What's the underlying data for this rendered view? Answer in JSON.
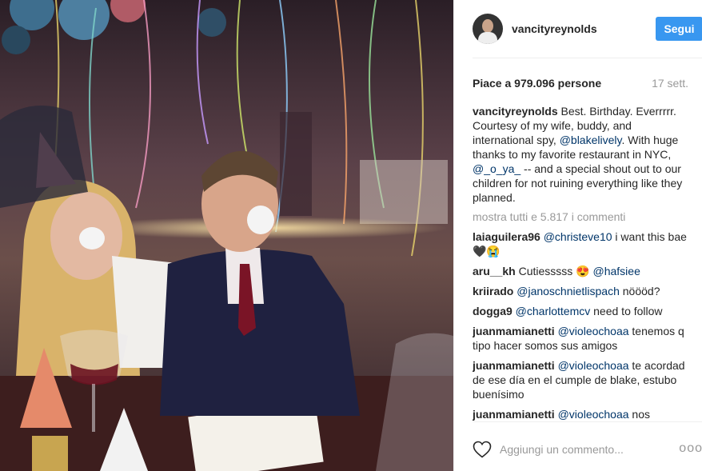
{
  "post": {
    "username": "vancityreynolds",
    "follow_label": "Segui",
    "likes_text": "Piace a 979.096 persone",
    "time_text": "17 sett.",
    "caption": {
      "user": "vancityreynolds",
      "text_1": " Best. Birthday. Everrrrr. Courtesy of my wife, buddy, and international spy, ",
      "mention_1": "@blakelively",
      "text_2": ". With huge thanks to my favorite restaurant in NYC, ",
      "mention_2": "@_o_ya_",
      "text_3": " -- and a special shout out to our children for not ruining everything like they planned."
    },
    "view_all": "mostra tutti e 5.817 i commenti",
    "comments": [
      {
        "user": "laiaguilera96",
        "mention": "@christeve10",
        "text": " i want this bae🖤😭"
      },
      {
        "user": "aru__kh",
        "mention": "",
        "text": " Cutiesssss 😍 ",
        "mention_after": "@hafsiee"
      },
      {
        "user": "kriirado",
        "mention": "@janoschnietlispach",
        "text": " nöööd?"
      },
      {
        "user": "dogga9",
        "mention": "@charlottemcv",
        "text": " need to follow"
      },
      {
        "user": "juanmamianetti",
        "mention": "@violeochoaa",
        "text": " tenemos q tipo hacer somos sus amigos"
      },
      {
        "user": "juanmamianetti",
        "mention": "@violeochoaa",
        "text": " te acordad de ese día en el cumple de blake, estubo buenísimo"
      },
      {
        "user": "juanmamianetti",
        "mention": "@violeochoaa",
        "text": " nos"
      }
    ],
    "comment_placeholder": "Aggiungi un commento...",
    "more_label": "ooo",
    "icons": {
      "like": "heart-icon",
      "options": "more-options-icon"
    }
  }
}
